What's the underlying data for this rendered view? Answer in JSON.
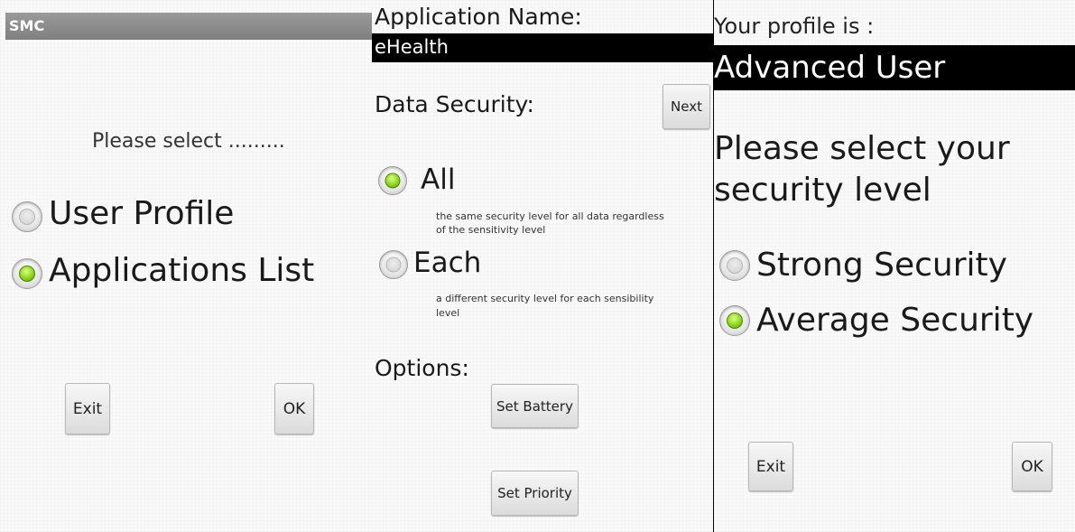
{
  "screen1": {
    "title": "SMC",
    "prompt": "Please select .........",
    "options": [
      "User Profile",
      "Applications List"
    ],
    "selected_option": "Applications List",
    "exit_label": "Exit",
    "ok_label": "OK"
  },
  "screen2": {
    "app_name_label": "Application Name:",
    "app_name_value": "eHealth",
    "data_security_label": "Data Security:",
    "next_label": "Next",
    "options": [
      {
        "label": "All",
        "description": "the same security level for all data regardless of the sensitivity level",
        "desc_line1": "the same security level for all data regardless",
        "desc_line2": "of the sensitivity level"
      },
      {
        "label": "Each",
        "description": "a different security level for each sensibility level",
        "desc_line1": "a different security level for each sensibility",
        "desc_line2": "level"
      }
    ],
    "selected_option": "All",
    "options_label": "Options:",
    "set_battery_label": "Set Battery",
    "set_priority_label": "Set Priority"
  },
  "screen3": {
    "profile_label": "Your profile is :",
    "profile_value": "Advanced User",
    "prompt_line1": "Please select your",
    "prompt_line2": "security level",
    "options": [
      "Strong Security",
      "Average Security"
    ],
    "selected_option": "Average Security",
    "exit_label": "Exit",
    "ok_label": "OK"
  },
  "colors": {
    "radio_selected": "#8fd61c",
    "title_bar": "#8a8a8a",
    "highlight_bar": "#000000"
  }
}
